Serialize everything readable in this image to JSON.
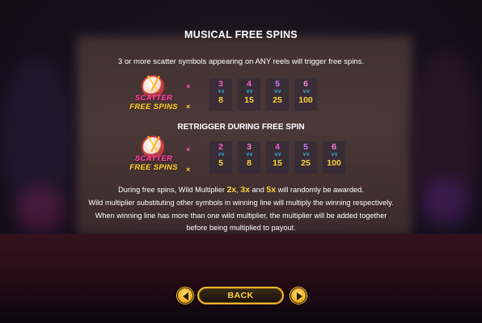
{
  "title": "MUSICAL FREE SPINS",
  "intro": "3 or more scatter symbols appearing on ANY reels  will trigger free spins.",
  "scatter": {
    "line1": "SCATTER",
    "line2": "FREE SPINS",
    "icon": "drum-icon"
  },
  "cross": "×",
  "table1": [
    {
      "count": "3",
      "pay": "8"
    },
    {
      "count": "4",
      "pay": "15"
    },
    {
      "count": "5",
      "pay": "25"
    },
    {
      "count": "6",
      "pay": "100"
    }
  ],
  "retrigger": "RETRIGGER DURING FREE SPIN",
  "table2": [
    {
      "count": "2",
      "pay": "5"
    },
    {
      "count": "3",
      "pay": "8"
    },
    {
      "count": "4",
      "pay": "15"
    },
    {
      "count": "5",
      "pay": "25"
    },
    {
      "count": "6",
      "pay": "100"
    }
  ],
  "desc": {
    "line1_pre": "During free spins, Wild Multiplier ",
    "mult2": "2x",
    "sep1": ", ",
    "mult3": "3x",
    "and": " and ",
    "mult5": "5x",
    "line1_post": " will randomly be awarded.",
    "line2": "Wild multiplier substituting other symbols in winning line will multiply the winning respectively.",
    "line3": "When winning line has more than one wild multiplier,  the multiplier will be added together",
    "line4": "before  being multiplied to payout."
  },
  "nav": {
    "back_label": "BACK",
    "prev_icon": "arrow-left-icon",
    "next_icon": "arrow-right-icon"
  },
  "colors": {
    "count_palette": [
      "#ffd23a",
      "#ff5ad0",
      "#c77bff",
      "#ff7fd5",
      "#ffffff"
    ],
    "payout": "#ffd23a",
    "chevron": "#38c6ff",
    "pink": "#ff4fb4",
    "accent": "#f3b62a"
  }
}
